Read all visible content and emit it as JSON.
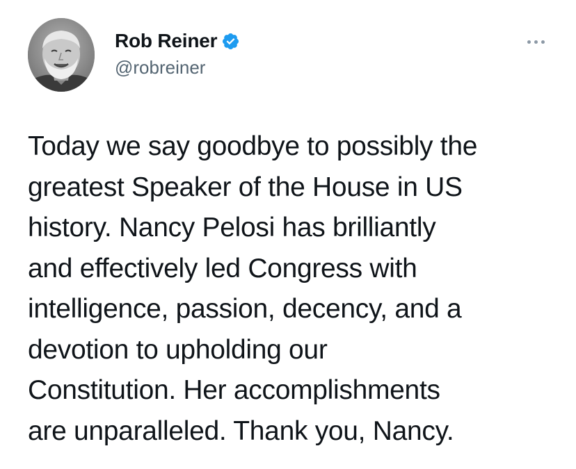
{
  "author": {
    "name": "Rob Reiner",
    "handle": "@robreiner",
    "verified": true,
    "verified_color": "#1d9bf0"
  },
  "icons": {
    "avatar": "profile-photo",
    "verified": "verified-badge-icon",
    "more": "more-horizontal-icon"
  },
  "tweet": {
    "lines": [
      "Today we say goodbye to possibly the",
      "greatest Speaker of the House in US",
      "history. Nancy Pelosi has brilliantly",
      "and effectively led Congress with",
      "intelligence, passion, decency, and a",
      "devotion to upholding our",
      "Constitution. Her accomplishments",
      "are unparalleled. Thank you, Nancy."
    ]
  },
  "colors": {
    "text": "#0f1419",
    "secondary_text": "#536471",
    "more_dots": "#8b98a5"
  }
}
